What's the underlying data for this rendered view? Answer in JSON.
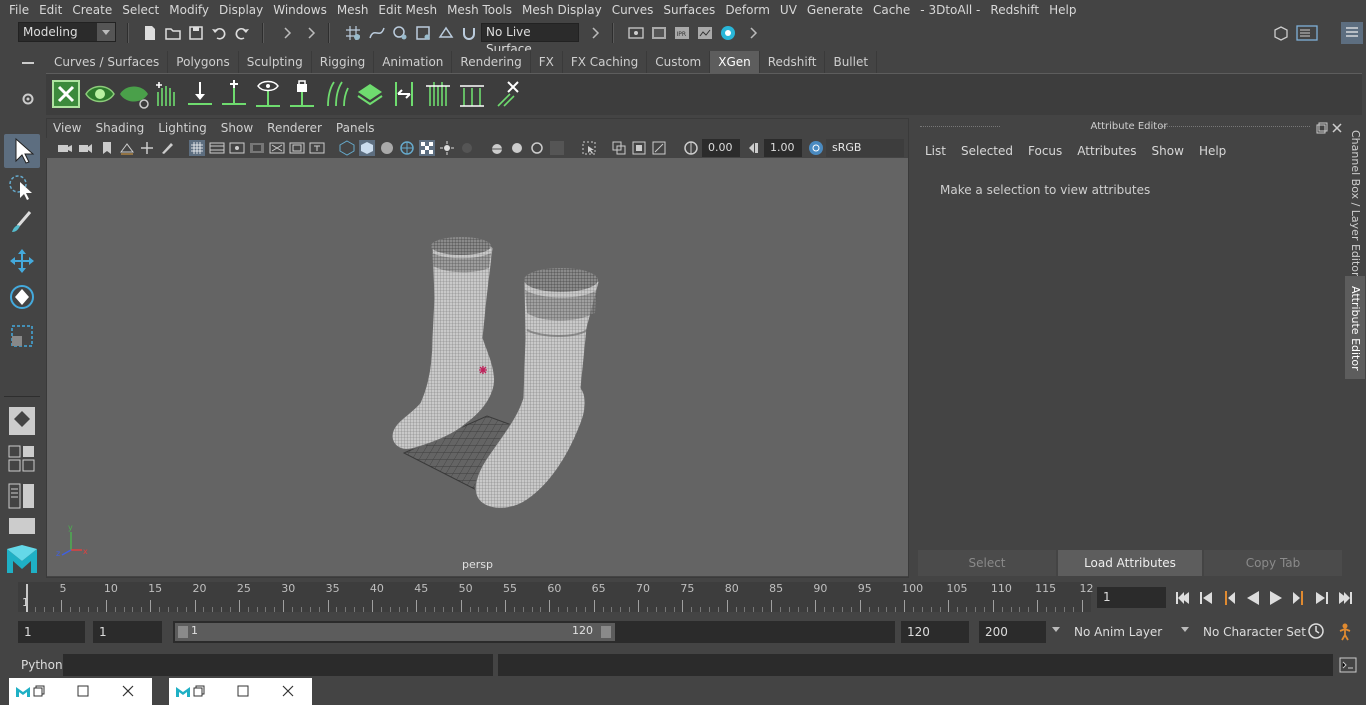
{
  "menubar": [
    "File",
    "Edit",
    "Create",
    "Select",
    "Modify",
    "Display",
    "Windows",
    "Mesh",
    "Edit Mesh",
    "Mesh Tools",
    "Mesh Display",
    "Curves",
    "Surfaces",
    "Deform",
    "UV",
    "Generate",
    "Cache",
    "- 3DtoAll -",
    "Redshift",
    "Help"
  ],
  "statusline": {
    "mode": "Modeling",
    "live_surface": "No Live Surface"
  },
  "shelf_tabs": [
    "Curves / Surfaces",
    "Polygons",
    "Sculpting",
    "Rigging",
    "Animation",
    "Rendering",
    "FX",
    "FX Caching",
    "Custom",
    "XGen",
    "Redshift",
    "Bullet"
  ],
  "shelf_active": "XGen",
  "viewport": {
    "menu": [
      "View",
      "Shading",
      "Lighting",
      "Show",
      "Renderer",
      "Panels"
    ],
    "exposure": "0.00",
    "gamma": "1.00",
    "colorspace": "sRGB gamma",
    "camera_label": "persp"
  },
  "attribute_editor": {
    "title": "Attribute Editor",
    "menu": [
      "List",
      "Selected",
      "Focus",
      "Attributes",
      "Show",
      "Help"
    ],
    "message": "Make a selection to view attributes",
    "buttons": {
      "select": "Select",
      "load": "Load Attributes",
      "copy": "Copy Tab"
    }
  },
  "side_tabs": {
    "channel_box": "Channel Box / Layer Editor",
    "attribute_editor": "Attribute Editor"
  },
  "timeline": {
    "labels": [
      "5",
      "10",
      "15",
      "20",
      "25",
      "30",
      "35",
      "40",
      "45",
      "50",
      "55",
      "60",
      "65",
      "70",
      "75",
      "80",
      "85",
      "90",
      "95",
      "100",
      "105",
      "110",
      "115",
      "12"
    ],
    "start_label": "1",
    "current_frame": "1"
  },
  "range": {
    "start": "1",
    "playback_start": "1",
    "slider_start": "1",
    "slider_end": "120",
    "playback_end": "120",
    "end": "200",
    "anim_layer": "No Anim Layer",
    "character_set": "No Character Set"
  },
  "command_line": {
    "language": "Python"
  }
}
